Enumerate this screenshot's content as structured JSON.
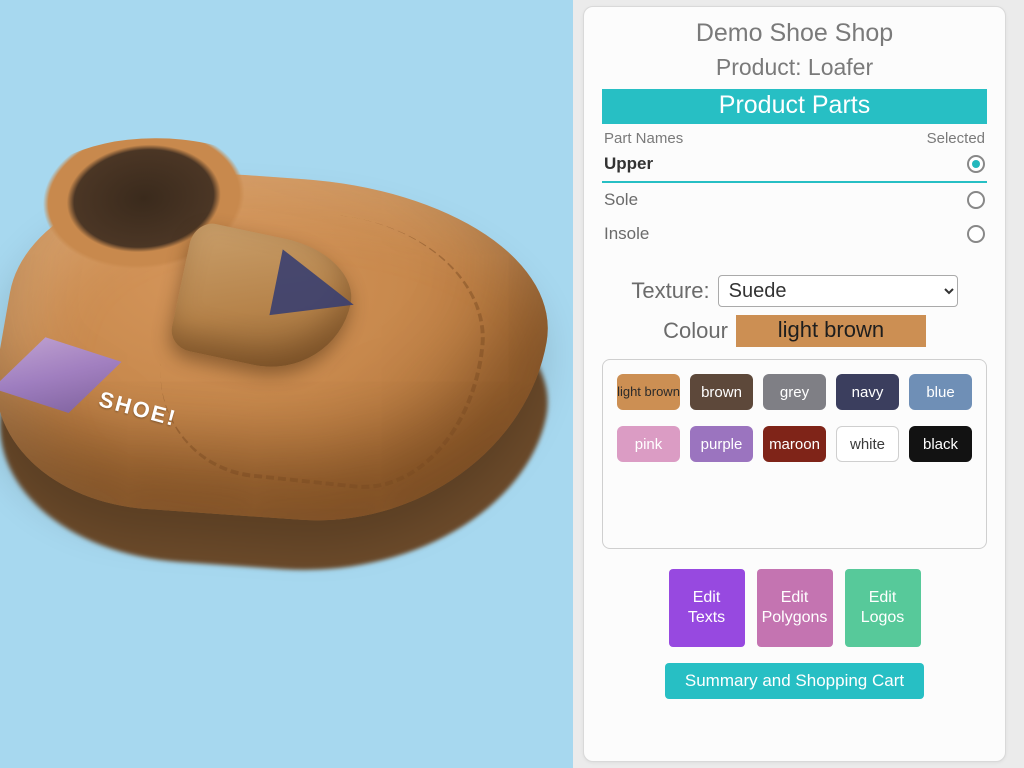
{
  "header": {
    "shop_name": "Demo Shoe Shop",
    "product_label": "Product: Loafer",
    "section_title": "Product Parts"
  },
  "parts_table": {
    "col_name": "Part Names",
    "col_selected": "Selected",
    "rows": [
      {
        "label": "Upper",
        "selected": true
      },
      {
        "label": "Sole",
        "selected": false
      },
      {
        "label": "Insole",
        "selected": false
      }
    ]
  },
  "texture": {
    "label": "Texture:",
    "value": "Suede"
  },
  "colour": {
    "label": "Colour",
    "value": "light brown",
    "chip_bg": "#cc8f53"
  },
  "swatches": [
    {
      "label": "light brown",
      "bg": "#cc8f53",
      "fg": "#2b2b2b",
      "two_line": true
    },
    {
      "label": "brown",
      "bg": "#5d483a",
      "fg": "#ffffff",
      "two_line": false
    },
    {
      "label": "grey",
      "bg": "#7f7f85",
      "fg": "#ffffff",
      "two_line": false
    },
    {
      "label": "navy",
      "bg": "#3b3e5e",
      "fg": "#ffffff",
      "two_line": false
    },
    {
      "label": "blue",
      "bg": "#6f8fb6",
      "fg": "#ffffff",
      "two_line": false
    },
    {
      "label": "pink",
      "bg": "#db9cc4",
      "fg": "#ffffff",
      "two_line": false
    },
    {
      "label": "purple",
      "bg": "#9b74bf",
      "fg": "#ffffff",
      "two_line": false
    },
    {
      "label": "maroon",
      "bg": "#7f2418",
      "fg": "#ffffff",
      "two_line": false
    },
    {
      "label": "white",
      "bg": "#ffffff",
      "fg": "#3a3a3a",
      "two_line": false
    },
    {
      "label": "black",
      "bg": "#121212",
      "fg": "#ffffff",
      "two_line": false
    }
  ],
  "edit_buttons": [
    {
      "label": "Edit Texts",
      "bg": "#9749e0"
    },
    {
      "label": "Edit Polygons",
      "bg": "#c474b1"
    },
    {
      "label": "Edit Logos",
      "bg": "#57c99a"
    }
  ],
  "cart_button": "Summary and Shopping Cart",
  "viewport": {
    "brand_text": "SHOE!"
  }
}
